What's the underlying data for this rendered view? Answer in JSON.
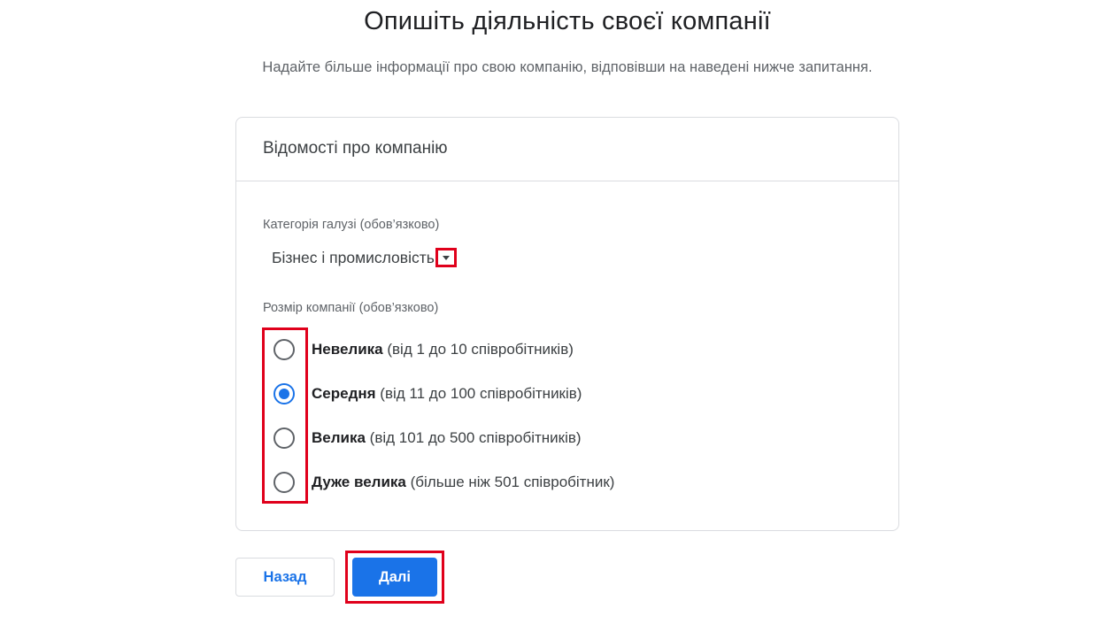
{
  "header": {
    "title": "Опишіть діяльність своєї компанії",
    "subtitle": "Надайте більше інформації про свою компанію, відповівши на наведені нижче запитання."
  },
  "card": {
    "title": "Відомості про компанію",
    "industry": {
      "label": "Категорія галузі (обов’язково)",
      "value": "Бізнес і промисловість"
    },
    "size": {
      "label": "Розмір компанії (обов’язково)",
      "options": [
        {
          "bold": "Невелика",
          "detail": " (від 1 до 10 співробітників)",
          "selected": false
        },
        {
          "bold": "Середня",
          "detail": " (від 11 до 100 співробітників)",
          "selected": true
        },
        {
          "bold": "Велика",
          "detail": " (від 101 до 500 співробітників)",
          "selected": false
        },
        {
          "bold": "Дуже велика",
          "detail": " (більше ніж 501 співробітник)",
          "selected": false
        }
      ]
    }
  },
  "actions": {
    "back_label": "Назад",
    "next_label": "Далі"
  },
  "colors": {
    "accent": "#1a73e8",
    "highlight": "#e0001b"
  }
}
